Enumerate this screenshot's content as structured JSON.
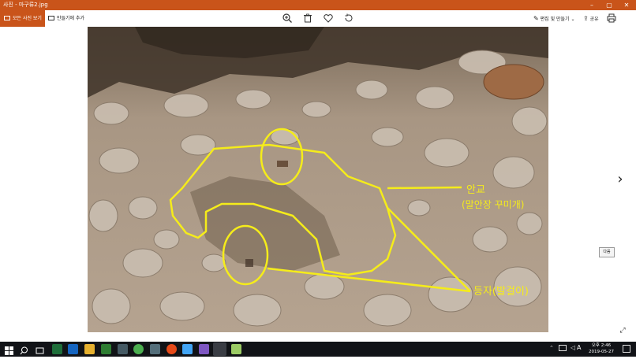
{
  "window": {
    "title": "사진 - 마구류2.jpg",
    "minimize": "–",
    "maximize": "▢",
    "close": "✕"
  },
  "toolbar": {
    "all_photos": "모든 사진 보기",
    "add_to_album": "만들기에 추가",
    "zoom_icon": "zoom-in-icon",
    "delete_icon": "trash-icon",
    "favorite_icon": "heart-icon",
    "rotate_icon": "rotate-icon",
    "edit_create": "편집 및 만들기",
    "share": "공유",
    "print_icon": "print-icon"
  },
  "photo": {
    "label_top_line1": "안교",
    "label_top_line2": "(말안장 꾸미개)",
    "label_bottom": "등자(발걸이)",
    "annotation_color": "#f5ec1a"
  },
  "navigation": {
    "next_arrow": "›",
    "next_tooltip": "다음",
    "expand": "⤢"
  },
  "taskbar": {
    "time": "오후 2:46",
    "date": "2019-05-27",
    "ime": "A",
    "background": "#111317"
  }
}
